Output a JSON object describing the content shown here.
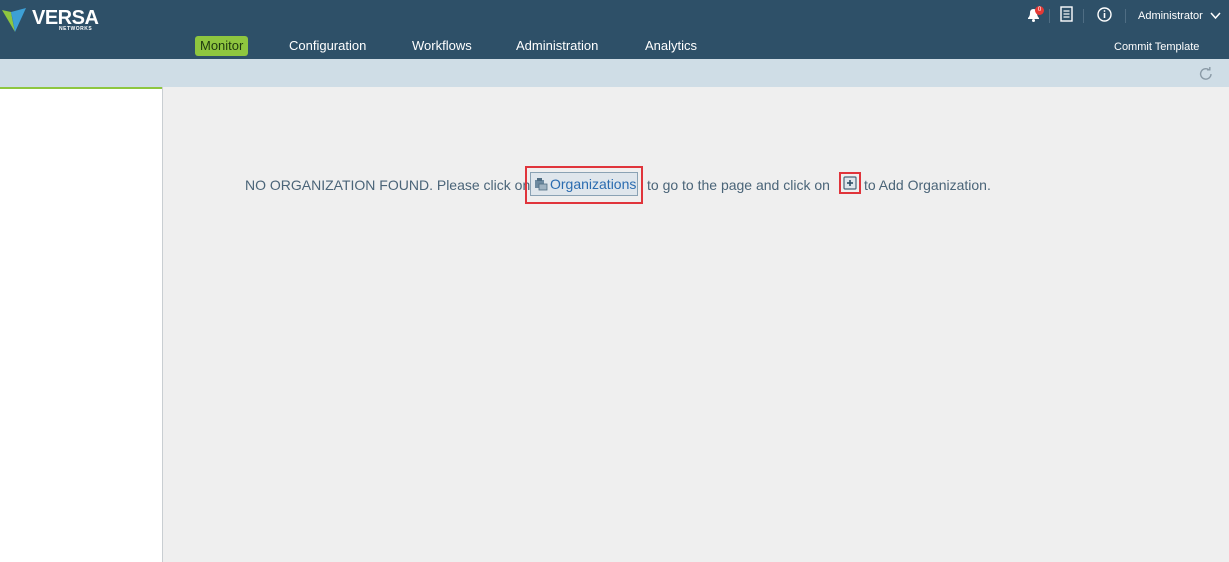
{
  "brand": {
    "name": "VERSA",
    "tagline": "NETWORKS",
    "accent_color": "#8ec63f",
    "header_color": "#2e5068"
  },
  "nav": {
    "items": [
      {
        "label": "Monitor",
        "active": true
      },
      {
        "label": "Configuration",
        "active": false
      },
      {
        "label": "Workflows",
        "active": false
      },
      {
        "label": "Administration",
        "active": false
      },
      {
        "label": "Analytics",
        "active": false
      }
    ]
  },
  "header": {
    "notifications_count": "0",
    "user": "Administrator",
    "commit_label": "Commit Template",
    "icons": [
      "bell-icon",
      "document-list-icon",
      "info-icon",
      "chevron-down-icon"
    ]
  },
  "toolbar": {
    "icons": [
      "refresh-icon"
    ]
  },
  "message": {
    "part1": "NO ORGANIZATION FOUND. Please click on",
    "link_label": "Organizations",
    "part2": "to go to the page and click on",
    "part3": "to Add Organization.",
    "link_icon": "organizations-icon",
    "add_icon": "add-icon",
    "highlight_color": "#e0343b"
  }
}
